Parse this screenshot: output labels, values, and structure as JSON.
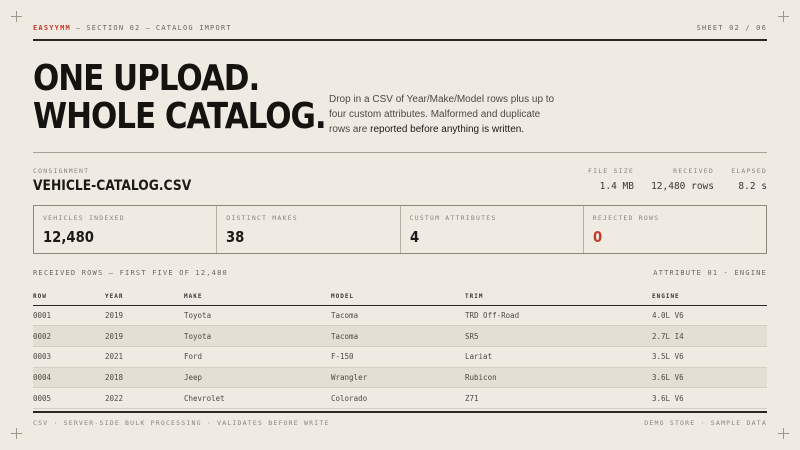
{
  "header": {
    "brand": "EASYYMM",
    "section": "SECTION 02",
    "title": "CATALOG IMPORT",
    "separator": "—",
    "sheet": "SHEET 02 / 06"
  },
  "hero": {
    "line1": "ONE UPLOAD.",
    "line2": "WHOLE CATALOG.",
    "intro": "Drop in a CSV of Year/Make/Model rows plus up to four custom attributes. Malformed and duplicate rows are",
    "intro_strong": "reported before anything is written."
  },
  "consignment": {
    "label": "CONSIGNMENT",
    "filename": "VEHICLE-CATALOG.CSV",
    "file_size_label": "FILE SIZE",
    "file_size": "1.4 MB",
    "received_label": "RECEIVED",
    "received": "12,480 rows",
    "elapsed_label": "ELAPSED",
    "elapsed": "8.2 s"
  },
  "stats": [
    {
      "label": "VEHICLES INDEXED",
      "value": "12,480"
    },
    {
      "label": "DISTINCT MAKES",
      "value": "38"
    },
    {
      "label": "CUSTOM ATTRIBUTES",
      "value": "4"
    },
    {
      "label": "REJECTED ROWS",
      "value": "0"
    }
  ],
  "accent_color": "#c23a2a",
  "rows_section": {
    "title": "RECEIVED ROWS — FIRST FIVE OF 12,480",
    "attribute": "ATTRIBUTE 01 · ENGINE"
  },
  "table": {
    "headers": [
      "ROW",
      "YEAR",
      "MAKE",
      "MODEL",
      "TRIM",
      "ENGINE"
    ],
    "rows": [
      [
        "0001",
        "2019",
        "Toyota",
        "Tacoma",
        "TRD Off-Road",
        "4.0L V6"
      ],
      [
        "0002",
        "2019",
        "Toyota",
        "Tacoma",
        "SR5",
        "2.7L I4"
      ],
      [
        "0003",
        "2021",
        "Ford",
        "F-150",
        "Lariat",
        "3.5L V6"
      ],
      [
        "0004",
        "2018",
        "Jeep",
        "Wrangler",
        "Rubicon",
        "3.6L V6"
      ],
      [
        "0005",
        "2022",
        "Chevrolet",
        "Colorado",
        "Z71",
        "3.6L V6"
      ]
    ]
  },
  "footer": {
    "left": "CSV · SERVER-SIDE BULK PROCESSING · VALIDATES BEFORE WRITE",
    "right": "DEMO STORE · SAMPLE DATA"
  }
}
